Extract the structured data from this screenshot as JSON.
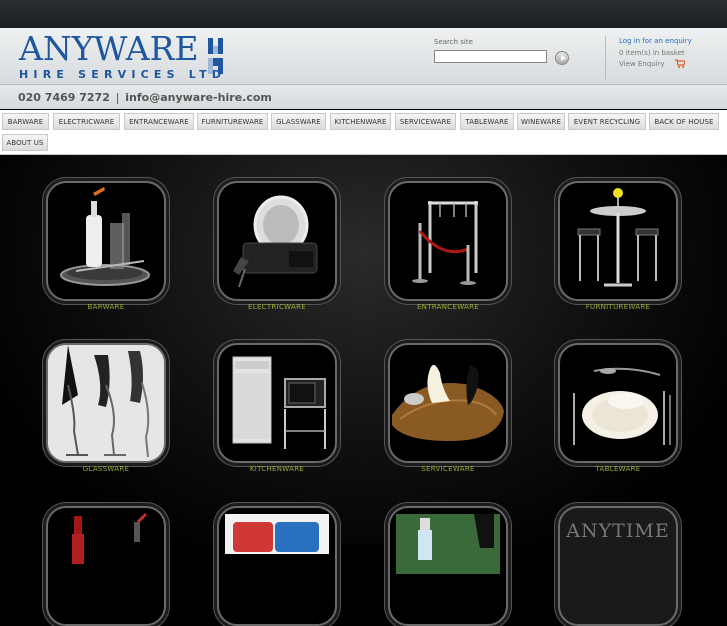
{
  "brand": {
    "name": "ANYWARE",
    "tagline": "HIRE SERVICES LTD",
    "color": "#1e56a0"
  },
  "search": {
    "label": "Search site",
    "value": "",
    "button_icon": "arrow-right-icon"
  },
  "enquiry": {
    "login_link": "Log in for an enquiry",
    "basket_count": "0 item(s) in basket",
    "view_link": "View Enquiry",
    "basket_icon": "basket-icon"
  },
  "contact": {
    "phone": "020 7469 7272",
    "separator": "|",
    "email": "info@anyware-hire.com"
  },
  "nav": {
    "items": [
      "BARWARE",
      "ELECTRICWARE",
      "ENTRANCEWARE",
      "FURNITUREWARE",
      "GLASSWARE",
      "KITCHENWARE",
      "SERVICEWARE",
      "TABLEWARE",
      "WINEWARE",
      "EVENT RECYCLING",
      "BACK OF HOUSE",
      "ABOUT US"
    ]
  },
  "categories": [
    {
      "label": "BARWARE"
    },
    {
      "label": "ELECTRICWARE"
    },
    {
      "label": "ENTRANCEWARE"
    },
    {
      "label": "FURNITUREWARE"
    },
    {
      "label": "GLASSWARE"
    },
    {
      "label": "KITCHENWARE"
    },
    {
      "label": "SERVICEWARE"
    },
    {
      "label": "TABLEWARE"
    },
    {
      "label": "",
      "overlay_text": ""
    },
    {
      "label": ""
    },
    {
      "label": ""
    },
    {
      "label": "",
      "overlay_text": "ANYTIME"
    }
  ],
  "colors": {
    "category_label": "#9cad2c",
    "link": "#2a6bbf"
  }
}
